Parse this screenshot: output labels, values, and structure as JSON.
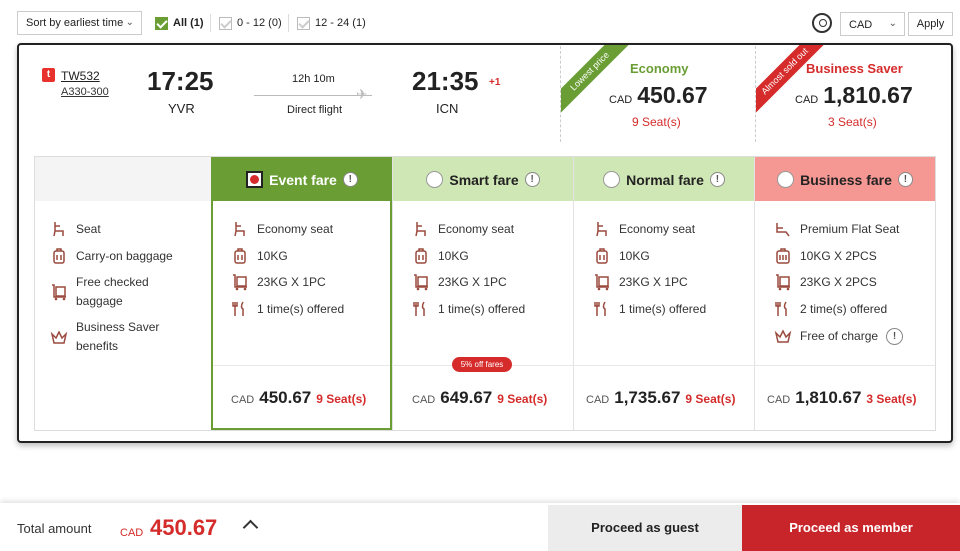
{
  "toolbar": {
    "sort_label": "Sort by earliest time",
    "filters": [
      {
        "label": "All (1)",
        "checked": true
      },
      {
        "label": "0 - 12 (0)",
        "checked": false
      },
      {
        "label": "12 - 24 (1)",
        "checked": false
      }
    ],
    "currency": "CAD",
    "apply_label": "Apply"
  },
  "flight": {
    "airline_logo": "t",
    "flight_number": "TW532",
    "aircraft": "A330-300",
    "depart_time": "17:25",
    "depart_airport": "YVR",
    "duration": "12h 10m",
    "flight_type": "Direct flight",
    "arrive_time": "21:35",
    "day_offset": "+1",
    "arrive_airport": "ICN"
  },
  "cabins": [
    {
      "ribbon": "Lowest price",
      "title": "Economy",
      "currency": "CAD",
      "price": "450.67",
      "seats": "9 Seat(s)",
      "color": "#6a9e35"
    },
    {
      "ribbon": "Almost sold out",
      "title": "Business Saver",
      "currency": "CAD",
      "price": "1,810.67",
      "seats": "3 Seat(s)",
      "color": "#d52b2b"
    }
  ],
  "feature_labels": [
    "Seat",
    "Carry-on baggage",
    "Free checked baggage",
    "Business Saver benefits"
  ],
  "fares": [
    {
      "name": "Event fare",
      "selected": true,
      "features": [
        "Economy seat",
        "10KG",
        "23KG X 1PC",
        "1 time(s) offered"
      ],
      "currency": "CAD",
      "price": "450.67",
      "seats": "9 Seat(s)"
    },
    {
      "name": "Smart fare",
      "selected": false,
      "promo": "5% off fares",
      "features": [
        "Economy seat",
        "10KG",
        "23KG X 1PC",
        "1 time(s) offered"
      ],
      "currency": "CAD",
      "price": "649.67",
      "seats": "9 Seat(s)"
    },
    {
      "name": "Normal fare",
      "selected": false,
      "features": [
        "Economy seat",
        "10KG",
        "23KG X 1PC",
        "1 time(s) offered"
      ],
      "currency": "CAD",
      "price": "1,735.67",
      "seats": "9 Seat(s)"
    },
    {
      "name": "Business fare",
      "selected": false,
      "features": [
        "Premium Flat Seat",
        "10KG X 2PCS",
        "23KG X 2PCS",
        "2 time(s) offered",
        "Free of charge"
      ],
      "currency": "CAD",
      "price": "1,810.67",
      "seats": "3 Seat(s)"
    }
  ],
  "footer": {
    "total_label": "Total amount",
    "currency": "CAD",
    "total": "450.67",
    "guest_button": "Proceed as guest",
    "member_button": "Proceed as member"
  },
  "colors": {
    "accent_green": "#6a9e35",
    "light_green": "#cfe6b5",
    "light_red": "#f59894",
    "brand_red": "#c8252a"
  }
}
